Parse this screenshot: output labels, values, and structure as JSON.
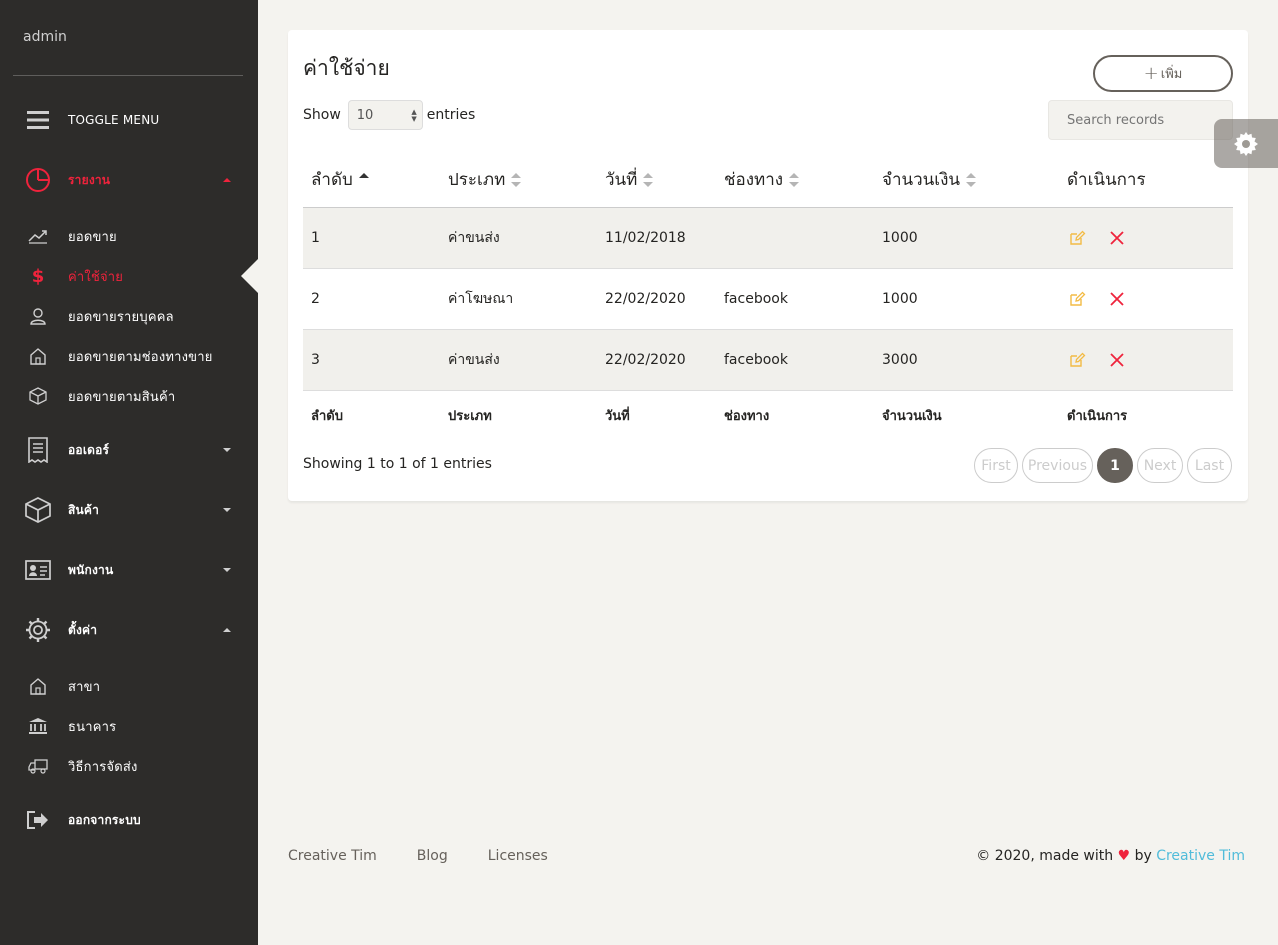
{
  "sidebar": {
    "user": "admin",
    "toggle": "TOGGLE MENU",
    "reports": "รายงาน",
    "sales": "ยอดขาย",
    "expenses": "ค่าใช้จ่าย",
    "sales_person": "ยอดขายรายบุคคล",
    "sales_channel": "ยอดขายตามช่องทางขาย",
    "sales_product": "ยอดขายตามสินค้า",
    "orders": "ออเดอร์",
    "products": "สินค้า",
    "employees": "พนักงาน",
    "settings": "ตั้งค่า",
    "branch": "สาขา",
    "bank": "ธนาคาร",
    "shipping": "วิธีการจัดส่ง",
    "logout": "ออกจากระบบ"
  },
  "card": {
    "title": "ค่าใช้จ่าย",
    "add_label": "เพิ่ม",
    "show_label": "Show",
    "entries_value": "10",
    "entries_label": "entries",
    "search_placeholder": "Search records"
  },
  "table": {
    "headers": [
      "ลำดับ",
      "ประเภท",
      "วันที่",
      "ช่องทาง",
      "จำนวนเงิน",
      "ดำเนินการ"
    ],
    "rows": [
      {
        "no": "1",
        "type": "ค่าขนส่ง",
        "date": "11/02/2018",
        "channel": "",
        "amount": "1000"
      },
      {
        "no": "2",
        "type": "ค่าโฆษณา",
        "date": "22/02/2020",
        "channel": "facebook",
        "amount": "1000"
      },
      {
        "no": "3",
        "type": "ค่าขนส่ง",
        "date": "22/02/2020",
        "channel": "facebook",
        "amount": "3000"
      }
    ],
    "footers": [
      "ลำดับ",
      "ประเภท",
      "วันที่",
      "ช่องทาง",
      "จำนวนเงิน",
      "ดำเนินการ"
    ]
  },
  "pagination": {
    "info": "Showing 1 to 1 of 1 entries",
    "first": "First",
    "previous": "Previous",
    "current": "1",
    "next": "Next",
    "last": "Last"
  },
  "footer": {
    "links": [
      "Creative Tim",
      "Blog",
      "Licenses"
    ],
    "copyright": "© 2020, made with",
    "by": "by",
    "author": "Creative Tim"
  },
  "colors": {
    "accent": "#ef233c",
    "warning": "#f3bb45",
    "sidebar_bg": "#2d2c2a",
    "info": "#51bcda"
  }
}
